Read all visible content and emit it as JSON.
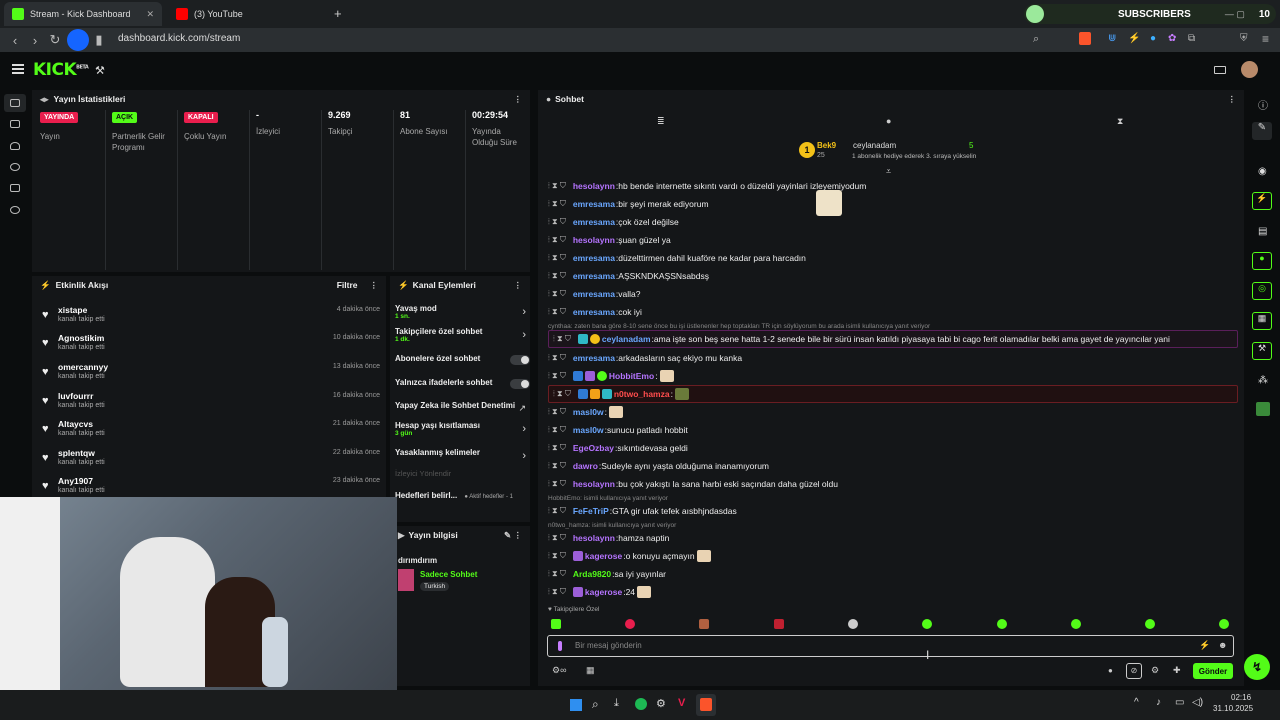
{
  "browser": {
    "tabs": [
      {
        "label": "Stream - Kick Dashboard",
        "active": true
      },
      {
        "label": "(3) YouTube",
        "active": false
      }
    ],
    "url": "dashboard.kick.com/stream",
    "subscribers_label": "SUBSCRIBERS",
    "subscribers_count": "10"
  },
  "kick": {
    "logo": "KICK",
    "logo_sup": "BETA"
  },
  "stats": {
    "title": "Yayın İstatistikleri",
    "cols": [
      {
        "badge": "YAYINDA",
        "badge_color": "#e91e4d",
        "label": "Yayın"
      },
      {
        "badge": "AÇIK",
        "badge_color": "#53fc18",
        "label": "Partnerlik Gelir Programı"
      },
      {
        "badge": "KAPALI",
        "badge_color": "#e91e4d",
        "label": "Çoklu Yayın"
      },
      {
        "value": "-",
        "label": "İzleyici"
      },
      {
        "value": "9.269",
        "label": "Takipçi"
      },
      {
        "value": "81",
        "label": "Abone Sayısı"
      },
      {
        "value": "00:29:54",
        "label": "Yayında Olduğu Süre"
      }
    ]
  },
  "activity": {
    "title": "Etkinlik Akışı",
    "filter": "Filtre",
    "items": [
      {
        "name": "xistape",
        "sub": "kanalı takip etti",
        "time": "4 dakika önce"
      },
      {
        "name": "Agnostikim",
        "sub": "kanalı takip etti",
        "time": "10 dakika önce"
      },
      {
        "name": "omercannyy",
        "sub": "kanalı takip etti",
        "time": "13 dakika önce"
      },
      {
        "name": "luvfourrr",
        "sub": "kanalı takip etti",
        "time": "16 dakika önce"
      },
      {
        "name": "Altaycvs",
        "sub": "kanalı takip etti",
        "time": "21 dakika önce"
      },
      {
        "name": "splentqw",
        "sub": "kanalı takip etti",
        "time": "22 dakika önce"
      },
      {
        "name": "Any1907",
        "sub": "kanalı takip etti",
        "time": "23 dakika önce"
      }
    ]
  },
  "channel_actions": {
    "title": "Kanal Eylemleri",
    "items": [
      {
        "t": "Yavaş mod",
        "s": "1 sn."
      },
      {
        "t": "Takipçilere özel sohbet",
        "s": "1 dk."
      },
      {
        "t": "Abonelere özel sohbet",
        "s": ""
      },
      {
        "t": "Yalnızca ifadelerle sohbet",
        "s": ""
      },
      {
        "t": "Yapay Zeka ile Sohbet Denetimi",
        "s": ""
      },
      {
        "t": "Hesap yaşı kısıtlaması",
        "s": "3 gün"
      },
      {
        "t": "Yasaklanmış kelimeler",
        "s": ""
      }
    ],
    "disabled": "İzleyici Yönlendir",
    "goals": "Hedefleri belirl...",
    "goals_status": "Aktif hedefler - 1"
  },
  "stream_info": {
    "title": "Yayın bilgisi",
    "name": "dırımdırım",
    "category": "Sadece Sohbet",
    "tag": "Turkish"
  },
  "chat": {
    "title": "Sohbet",
    "top_user": "Bek9",
    "top_num": "25",
    "gift_user": "ceylanadam",
    "gift_count": "5",
    "gift_text": "1 abonelik hediye ederek 3. sıraya yükselin",
    "messages": [
      {
        "u": "hesolaynn",
        "c": "#b574ff",
        "m": "hb bende internette sıkıntı vardı o düzeldi yayinlari izleyemiyodum"
      },
      {
        "u": "emresama",
        "c": "#6aa7ff",
        "m": "bir şeyi merak ediyorum"
      },
      {
        "u": "emresama",
        "c": "#6aa7ff",
        "m": "çok özel değilse"
      },
      {
        "u": "hesolaynn",
        "c": "#b574ff",
        "m": "şuan güzel ya"
      },
      {
        "u": "emresama",
        "c": "#6aa7ff",
        "m": "düzelttirmen dahil kuaföre ne kadar para harcadın"
      },
      {
        "u": "emresama",
        "c": "#6aa7ff",
        "m": "AŞSKNDKAŞSNsabdsş"
      },
      {
        "u": "emresama",
        "c": "#6aa7ff",
        "m": "valla?"
      },
      {
        "u": "emresama",
        "c": "#6aa7ff",
        "m": "cok iyi"
      }
    ],
    "reply1": "cynthaa: zaten bana göre 8-10 sene önce bu işi üstlenenler hep toptakları TR için söylüyorum bu arada isimli kullanıcıya yanıt veriyor",
    "highlight": {
      "u": "ceylanadam",
      "c": "#6aa7ff",
      "m": "ama işte son beş sene hatta 1-2 senede bile bir sürü insan katıldı piyasaya tabi bi cago ferit olamadılar belki ama gayet de yayıncılar yani"
    },
    "messages2": [
      {
        "u": "emresama",
        "c": "#6aa7ff",
        "m": "arkadasların saç ekiyo mu kanka"
      },
      {
        "u": "HobbitEmo",
        "c": "#b574ff",
        "m": ""
      },
      {
        "u": "n0two_hamza",
        "c": "#ff4d4d",
        "m": ""
      },
      {
        "u": "masl0w",
        "c": "#6aa7ff",
        "m": ""
      },
      {
        "u": "masl0w",
        "c": "#6aa7ff",
        "m": "sunucu patladı hobbit"
      },
      {
        "u": "EgeOzbay",
        "c": "#b574ff",
        "m": "sıkıntıdevasa geldi"
      },
      {
        "u": "dawro",
        "c": "#b574ff",
        "m": "Sudeyle aynı yaşta olduğuma inanamıyorum"
      },
      {
        "u": "hesolaynn",
        "c": "#b574ff",
        "m": "bu çok yakıştı la sana harbi eski saçından daha güzel oldu"
      }
    ],
    "reply2": "HobbitEmo:       isimli kullanıcıya yanıt veriyor",
    "msg_fef": {
      "u": "FeFeTriP",
      "c": "#6aa7ff",
      "m": "GTA gir ufak tefek aısbhjndasdas"
    },
    "reply3": "n0two_hamza:       isimli kullanıcıya yanıt veriyor",
    "messages3": [
      {
        "u": "hesolaynn",
        "c": "#b574ff",
        "m": "hamza naptin"
      },
      {
        "u": "kagerose",
        "c": "#b574ff",
        "m": "o konuyu açmayın"
      },
      {
        "u": "Arda9820",
        "c": "#53fc18",
        "m": "sa iyi yayınlar"
      },
      {
        "u": "kagerose",
        "c": "#b574ff",
        "m": "24"
      }
    ],
    "followers_only": "Takipçilere Özel",
    "input_placeholder": "Bir mesaj gönderin",
    "send": "Gönder"
  },
  "taskbar": {
    "time": "02:16",
    "date": "31.10.2025"
  }
}
